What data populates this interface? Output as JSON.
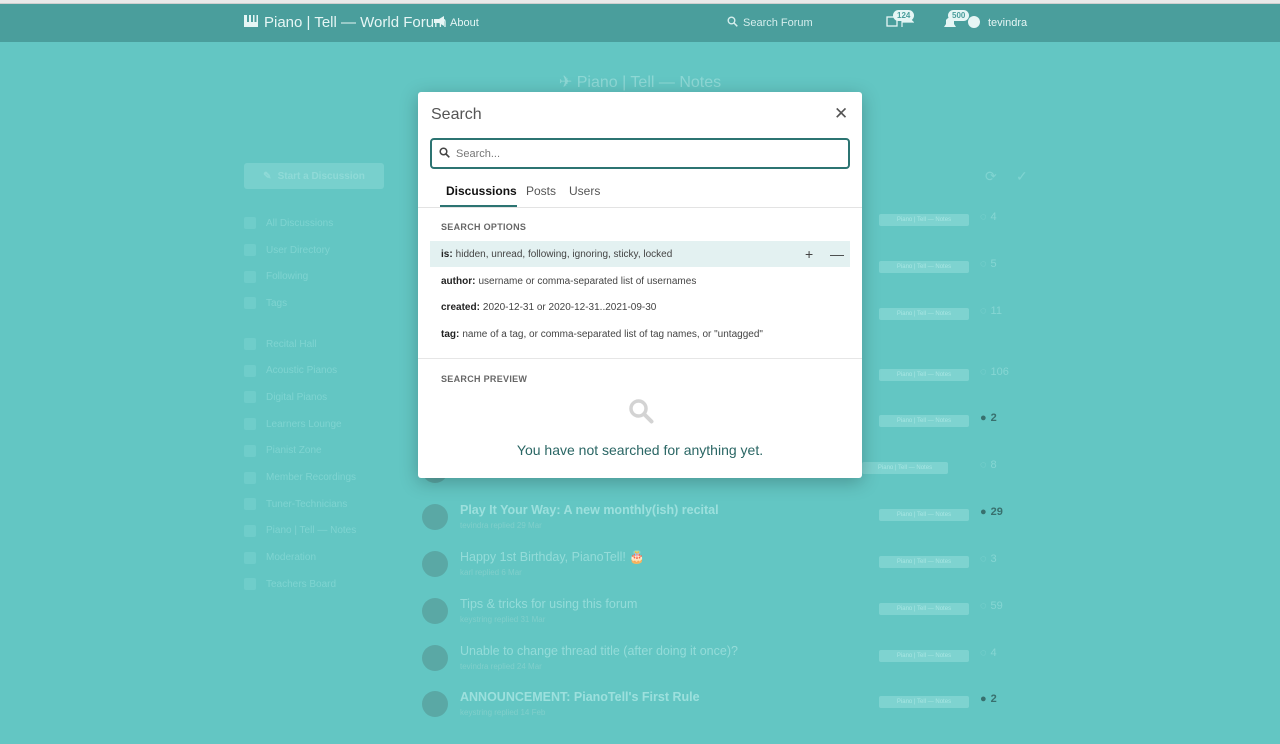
{
  "header": {
    "brand": "Piano | Tell — World Forum",
    "about": "About",
    "search_hint": "Search Forum",
    "badge_notifications": "124",
    "badge_user": "500",
    "username": "tevindra"
  },
  "hero": {
    "title": "Piano | Tell — Notes"
  },
  "sidebar": {
    "start_button": "Start a Discussion",
    "items": [
      {
        "label": "All Discussions",
        "icon": "comments-icon"
      },
      {
        "label": "User Directory",
        "icon": "directory-icon"
      },
      {
        "label": "Following",
        "icon": "star-icon"
      },
      {
        "label": "Tags",
        "icon": "tags-icon"
      },
      {
        "label": "Recital Hall",
        "icon": "building-icon"
      },
      {
        "label": "Acoustic Pianos",
        "icon": "piano-icon"
      },
      {
        "label": "Digital Pianos",
        "icon": "wave-icon"
      },
      {
        "label": "Learners Lounge",
        "icon": "lounge-icon"
      },
      {
        "label": "Pianist Zone",
        "icon": "headphones-icon"
      },
      {
        "label": "Member Recordings",
        "icon": "monitor-icon"
      },
      {
        "label": "Tuner-Technicians",
        "icon": "hammer-icon"
      },
      {
        "label": "Piano | Tell — Notes",
        "icon": "paper-plane-icon"
      },
      {
        "label": "Moderation",
        "icon": "book-icon"
      },
      {
        "label": "Teachers Board",
        "icon": "school-icon"
      }
    ]
  },
  "discussions": [
    {
      "title": "",
      "meta": "",
      "tag": "Piano | Tell — Notes",
      "count": "4",
      "strong": false
    },
    {
      "title": "",
      "meta": "",
      "tag": "Piano | Tell — Notes",
      "count": "5",
      "strong": false
    },
    {
      "title": "",
      "meta": "",
      "tag": "Piano | Tell — Notes",
      "count": "11",
      "strong": false
    },
    {
      "title": "",
      "meta": "",
      "tag": "Piano | Tell — Notes",
      "count": "106",
      "strong": false
    },
    {
      "title": "",
      "meta": "",
      "tag": "Piano | Tell — Notes",
      "count": "2",
      "strong": true
    },
    {
      "title": "",
      "meta": "",
      "tag": "Piano | Tell — Notes",
      "count": "8",
      "strong": false
    },
    {
      "title": "Play It Your Way: A new monthly(ish) recital",
      "meta": "tevindra replied 29 Mar",
      "tag": "Piano | Tell — Notes",
      "count": "29",
      "strong": true
    },
    {
      "title": "Happy 1st Birthday, PianoTell! 🎂",
      "meta": "karl replied 6 Mar",
      "tag": "Piano | Tell — Notes",
      "count": "3",
      "strong": false
    },
    {
      "title": "Tips & tricks for using this forum",
      "meta": "keystring replied 31 Mar",
      "tag": "Piano | Tell — Notes",
      "count": "59",
      "strong": false
    },
    {
      "title": "Unable to change thread title (after doing it once)?",
      "meta": "tevindra replied 24 Mar",
      "tag": "Piano | Tell — Notes",
      "count": "4",
      "strong": false
    },
    {
      "title": "ANNOUNCEMENT: PianoTell's First Rule",
      "meta": "keystring replied 14 Feb",
      "tag": "Piano | Tell — Notes",
      "count": "2",
      "strong": true
    }
  ],
  "modal": {
    "title": "Search",
    "placeholder": "Search...",
    "tabs": [
      "Discussions",
      "Posts",
      "Users"
    ],
    "options_label": "SEARCH OPTIONS",
    "options": [
      {
        "key": "is:",
        "desc": "hidden, unread, following, ignoring, sticky, locked"
      },
      {
        "key": "author:",
        "desc": "username or comma-separated list of usernames"
      },
      {
        "key": "created:",
        "desc": "2020-12-31 or 2020-12-31..2021-09-30"
      },
      {
        "key": "tag:",
        "desc": "name of a tag, or comma-separated list of tag names, or \"untagged\""
      }
    ],
    "preview_label": "SEARCH PREVIEW",
    "empty_text": "You have not searched for anything yet."
  }
}
